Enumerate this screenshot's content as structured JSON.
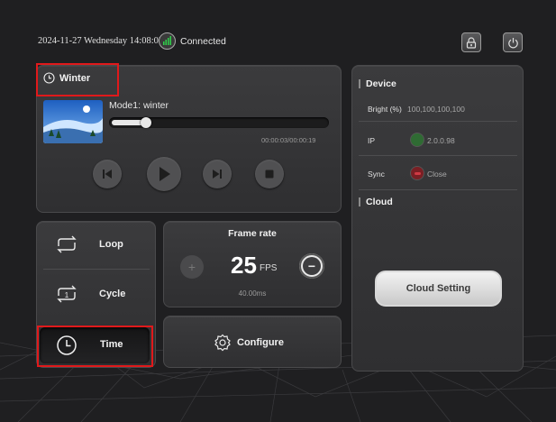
{
  "status": {
    "datetime": "2024-11-27 Wednesday 14:08:05",
    "connection": "Connected"
  },
  "top_buttons": {
    "lock": "lock-icon",
    "power": "power-icon"
  },
  "player": {
    "program_name": "Winter",
    "mode_label": "Mode1:  winter",
    "time": "00:00:03/00:00:19",
    "progress": 0.16
  },
  "modes": [
    {
      "label": "Loop"
    },
    {
      "label": "Cycle"
    },
    {
      "label": "Time"
    }
  ],
  "frame_rate": {
    "title": "Frame rate",
    "value": "25",
    "unit": "FPS",
    "interval": "40.00ms",
    "plus": "+",
    "minus": "−"
  },
  "configure": {
    "label": "Configure"
  },
  "device": {
    "title": "Device",
    "bright_label": "Bright (%)",
    "bright_value": "100,100,100,100",
    "ip_label": "IP",
    "ip_value": "2.0.0.98",
    "sync_label": "Sync",
    "sync_value": "Close"
  },
  "cloud": {
    "title": "Cloud",
    "button_label": "Cloud Setting"
  }
}
